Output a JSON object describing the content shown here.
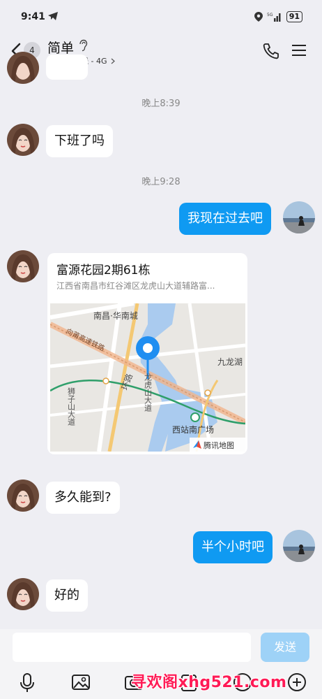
{
  "status": {
    "time": "9:41",
    "battery": "91"
  },
  "header": {
    "badge": "4",
    "title": "简单",
    "presence": "手机在线 - 4G",
    "presence_color": "#22c35e"
  },
  "messages": {
    "ts1": "晚上8:39",
    "m1": "下班了吗",
    "ts2": "晚上9:28",
    "m2": "我现在过去吧",
    "location": {
      "title": "富源花园2期61栋",
      "address": "江西省南昌市红谷滩区龙虎山大道辅路富...",
      "map_labels": {
        "area": "南昌·华南城",
        "railway": "向莆高速铁路",
        "lake": "九龙湖",
        "road1": "环路",
        "road2": "龙虎山大道",
        "road3": "狮子山大道",
        "station": "西站南广场",
        "provider": "腾讯地图"
      }
    },
    "m3": "多久能到?",
    "m4": "半个小时吧",
    "m5": "好的"
  },
  "input": {
    "placeholder": "",
    "send_label": "发送"
  },
  "toolbar": [
    "mic-icon",
    "image-icon",
    "camera-icon",
    "file-icon",
    "emoji-icon",
    "plus-icon"
  ],
  "watermark": "寻欢阁xhg521.com",
  "colors": {
    "my_bubble": "#0f9af2",
    "send_button": "#9ed2f7",
    "background": "#eeeef3"
  }
}
